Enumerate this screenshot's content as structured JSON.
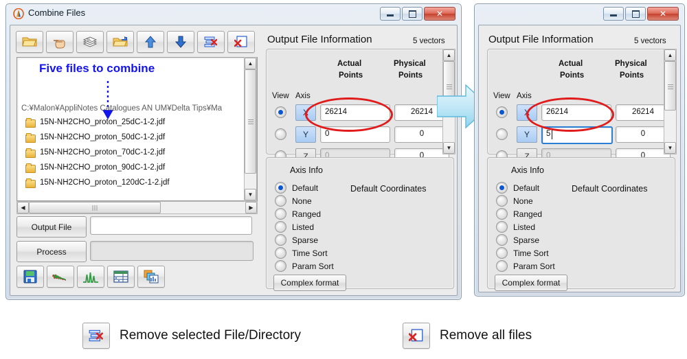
{
  "left_window": {
    "title": "Combine Files",
    "app_icon": "jeol-delta-icon",
    "window_buttons": {
      "minimize": "minimize-icon",
      "maximize": "maximize-icon",
      "close": "close-icon"
    },
    "toolbar": [
      {
        "name": "open-folder-button",
        "icon": "open-folder-icon",
        "tip": "Open"
      },
      {
        "name": "select-hand-button",
        "icon": "hand-pointer-icon",
        "tip": "Select"
      },
      {
        "name": "stack-files-button",
        "icon": "stacked-sheets-icon",
        "tip": "Stack"
      },
      {
        "name": "open-directory-button",
        "icon": "folder-arrow-icon",
        "tip": "Add directory"
      },
      {
        "name": "move-up-button",
        "icon": "arrow-up-icon",
        "tip": "Move up"
      },
      {
        "name": "move-down-button",
        "icon": "arrow-down-icon",
        "tip": "Move down"
      },
      {
        "name": "remove-selected-button",
        "icon": "list-remove-icon",
        "tip": "Remove selected File/Directory"
      },
      {
        "name": "remove-all-button",
        "icon": "page-remove-icon",
        "tip": "Remove all files"
      }
    ],
    "annotation": "Five files to combine",
    "path": "C:¥Malon¥AppliNotes Catalogues AN UM¥Delta Tips¥Ma",
    "files": [
      "15N-NH2CHO_proton_25dC-1-2.jdf",
      "15N-NH2CHO_proton_50dC-1-2.jdf",
      "15N-NH2CHO_proton_70dC-1-2.jdf",
      "15N-NH2CHO_proton_90dC-1-2.jdf",
      "15N-NH2CHO_proton_120dC-1-2.jdf"
    ],
    "output_file": {
      "label": "Output File",
      "value": "",
      "placeholder": ""
    },
    "process": {
      "label": "Process",
      "value": "",
      "placeholder": ""
    },
    "bottom_toolbar": [
      {
        "name": "save-button",
        "icon": "floppy-save-icon"
      },
      {
        "name": "fid-button",
        "icon": "waveform-fid-icon"
      },
      {
        "name": "spectrum-button",
        "icon": "spectrum-peaks-icon"
      },
      {
        "name": "table-button",
        "icon": "data-table-icon"
      },
      {
        "name": "multi-window-button",
        "icon": "cascade-windows-icon"
      }
    ]
  },
  "output_panel_left": {
    "title": "Output File Information",
    "vectors": "5 vectors",
    "headers": {
      "view": "View",
      "axis": "Axis",
      "actual": "Actual\nPoints",
      "actual_l1": "Actual",
      "actual_l2": "Points",
      "physical_l1": "Physical",
      "physical_l2": "Points"
    },
    "rows": [
      {
        "axis": "X",
        "view_selected": true,
        "actual": "26214",
        "physical": "26214",
        "disabled": false
      },
      {
        "axis": "Y",
        "view_selected": false,
        "actual": "0",
        "physical": "0",
        "disabled": false
      },
      {
        "axis": "Z",
        "view_selected": false,
        "actual": "0",
        "physical": "0",
        "disabled": true
      }
    ],
    "axis_info": {
      "title": "Axis Info",
      "coordinates": "Default Coordinates",
      "options": [
        "Default",
        "None",
        "Ranged",
        "Listed",
        "Sparse",
        "Time Sort",
        "Param Sort"
      ],
      "selected": "Default",
      "complex_format": "Complex format"
    }
  },
  "output_panel_right": {
    "title": "Output File Information",
    "vectors": "5 vectors",
    "headers": {
      "view": "View",
      "axis": "Axis",
      "actual_l1": "Actual",
      "actual_l2": "Points",
      "physical_l1": "Physical",
      "physical_l2": "Points"
    },
    "window_buttons": {
      "minimize": "minimize-icon",
      "maximize": "maximize-icon",
      "close": "close-icon"
    },
    "rows": [
      {
        "axis": "X",
        "view_selected": true,
        "actual": "26214",
        "physical": "26214",
        "disabled": false,
        "focused": false
      },
      {
        "axis": "Y",
        "view_selected": false,
        "actual": "5",
        "physical": "0",
        "disabled": false,
        "focused": true
      },
      {
        "axis": "Z",
        "view_selected": false,
        "actual": "0",
        "physical": "0",
        "disabled": true,
        "focused": false
      }
    ],
    "axis_info": {
      "title": "Axis Info",
      "coordinates": "Default Coordinates",
      "options": [
        "Default",
        "None",
        "Ranged",
        "Listed",
        "Sparse",
        "Time Sort",
        "Param Sort"
      ],
      "selected": "Default",
      "complex_format": "Complex format"
    }
  },
  "legend": [
    {
      "icon": "list-remove-icon",
      "text": "Remove selected File/Directory"
    },
    {
      "icon": "page-remove-icon",
      "text": "Remove all files"
    }
  ],
  "colors": {
    "annotation_blue": "#1414ee",
    "highlight_red": "#e01b1b",
    "arrow_cyan": "#a8e2f5",
    "axis_blue": "#a9ccf4"
  }
}
